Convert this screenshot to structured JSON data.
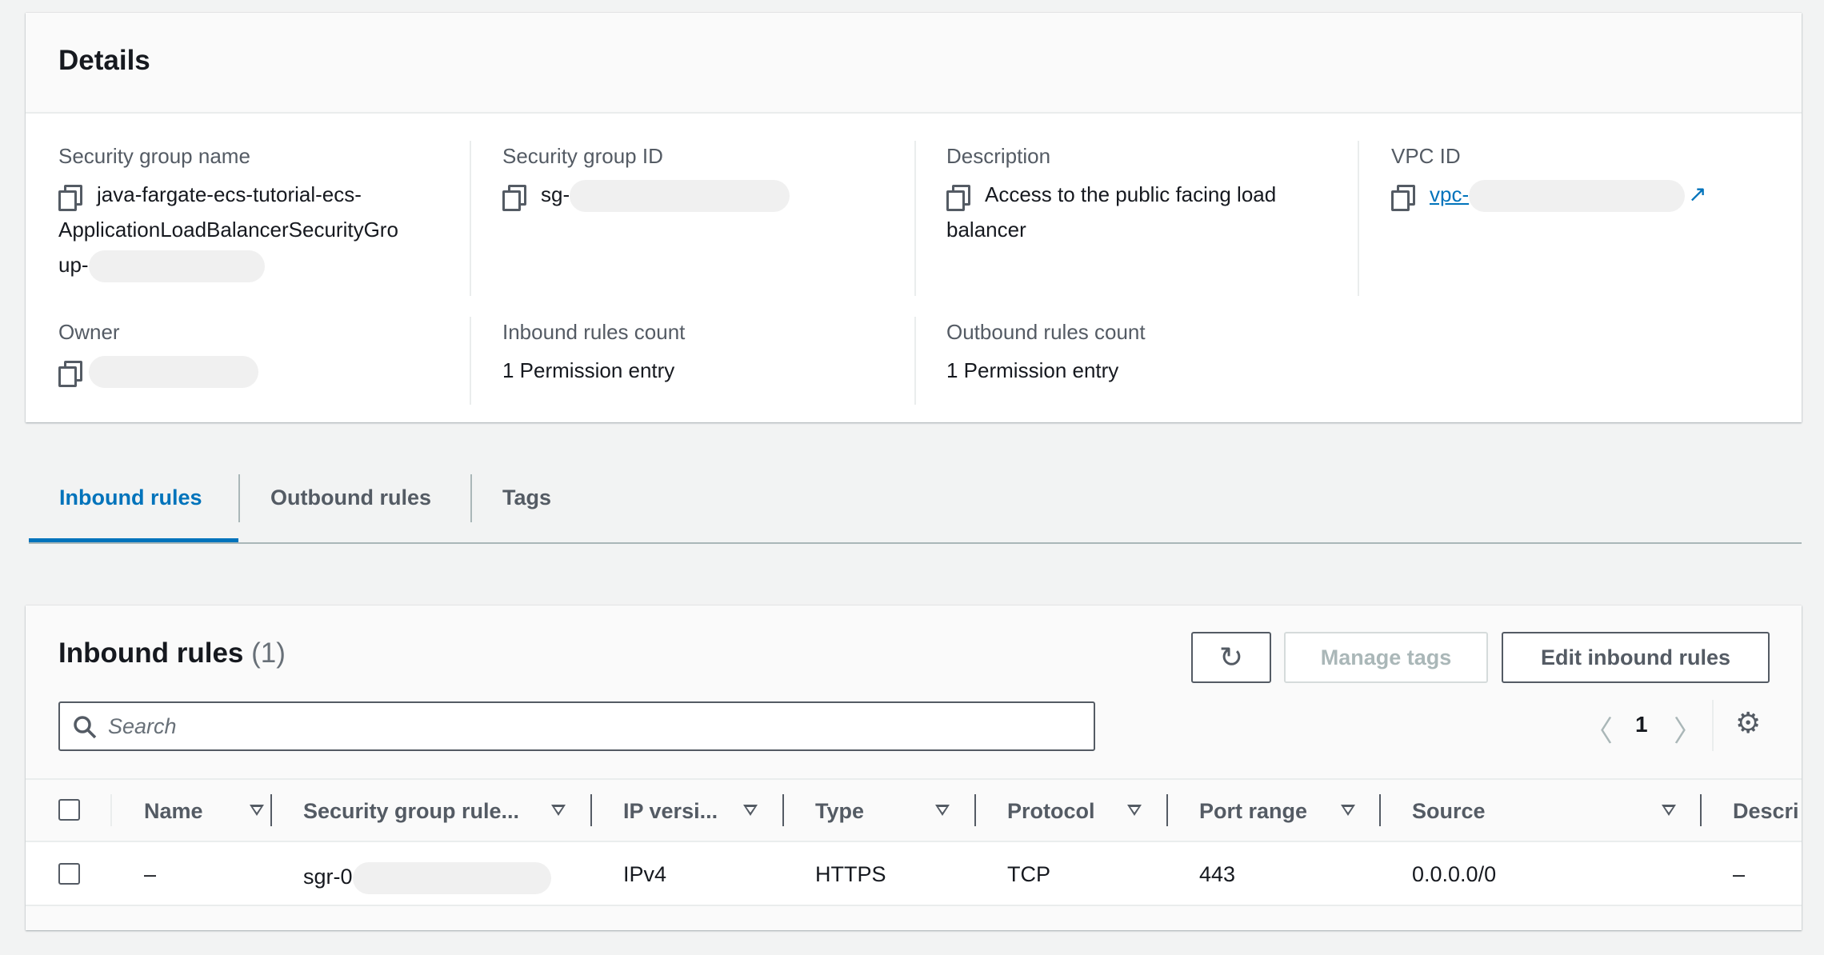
{
  "details": {
    "title": "Details",
    "fields": {
      "sg_name": {
        "label": "Security group name",
        "value_line1": "java-fargate-ecs-tutorial-ecs-",
        "value_line2": "ApplicationLoadBalancerSecurityGro",
        "value_line3": "up-"
      },
      "sg_id": {
        "label": "Security group ID",
        "value": "sg-"
      },
      "description": {
        "label": "Description",
        "value_line1": "Access to the public facing load",
        "value_line2": "balancer"
      },
      "vpc_id": {
        "label": "VPC ID",
        "value": "vpc-"
      },
      "owner": {
        "label": "Owner"
      },
      "inbound_count": {
        "label": "Inbound rules count",
        "value": "1 Permission entry"
      },
      "outbound_count": {
        "label": "Outbound rules count",
        "value": "1 Permission entry"
      }
    }
  },
  "tabs": [
    {
      "label": "Inbound rules",
      "active": true
    },
    {
      "label": "Outbound rules"
    },
    {
      "label": "Tags"
    }
  ],
  "rules": {
    "title": "Inbound rules",
    "count": "(1)",
    "manage_tags": "Manage tags",
    "edit": "Edit inbound rules",
    "search_placeholder": "Search",
    "page": "1",
    "columns": [
      "Name",
      "Security group rule...",
      "IP versi...",
      "Type",
      "Protocol",
      "Port range",
      "Source",
      "Descri"
    ],
    "rows": [
      {
        "name": "–",
        "rule_id": "sgr-0",
        "ip": "IPv4",
        "type": "HTTPS",
        "protocol": "TCP",
        "port": "443",
        "source": "0.0.0.0/0",
        "description": "–"
      }
    ]
  },
  "colors": {
    "accent": "#0073bb",
    "text": "#16191f",
    "muted": "#545b64"
  }
}
